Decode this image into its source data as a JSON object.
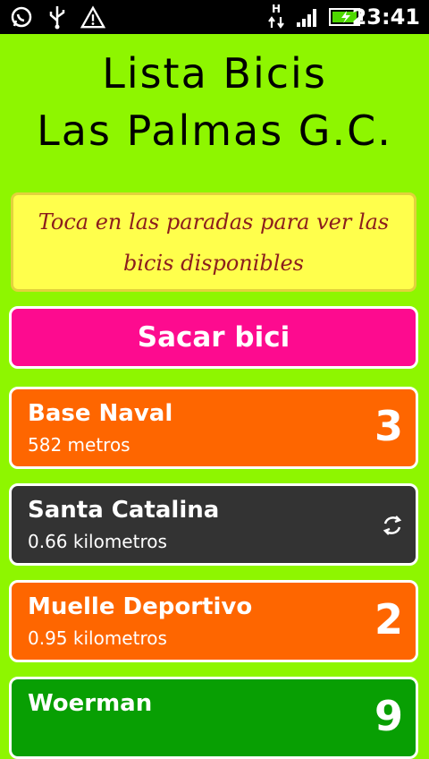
{
  "status_bar": {
    "left_icons": [
      "whatsapp-icon",
      "usb-icon",
      "warning-icon"
    ],
    "network_label": "H",
    "time": "23:41"
  },
  "title": {
    "line1": "Lista Bicis",
    "line2": "Las Palmas G.C."
  },
  "hint": "Toca en las paradas para ver las bicis disponibles",
  "sacar_button": "Sacar bici",
  "stations": [
    {
      "name": "Base Naval",
      "distance": "582 metros",
      "bikes": "3",
      "state": "loaded",
      "color": "#fe6600"
    },
    {
      "name": "Santa Catalina",
      "distance": "0.66 kilometros",
      "bikes": "",
      "state": "loading",
      "color": "#333333"
    },
    {
      "name": "Muelle Deportivo",
      "distance": "0.95 kilometros",
      "bikes": "2",
      "state": "loaded",
      "color": "#fe6600"
    },
    {
      "name": "Woerman",
      "distance": "",
      "bikes": "9",
      "state": "loaded",
      "color": "#089f03"
    }
  ],
  "colors": {
    "background": "#8ef600",
    "hint_bg": "#ffff4c",
    "hint_text": "#8b1d1d",
    "sacar_bg": "#fd0b8f"
  }
}
